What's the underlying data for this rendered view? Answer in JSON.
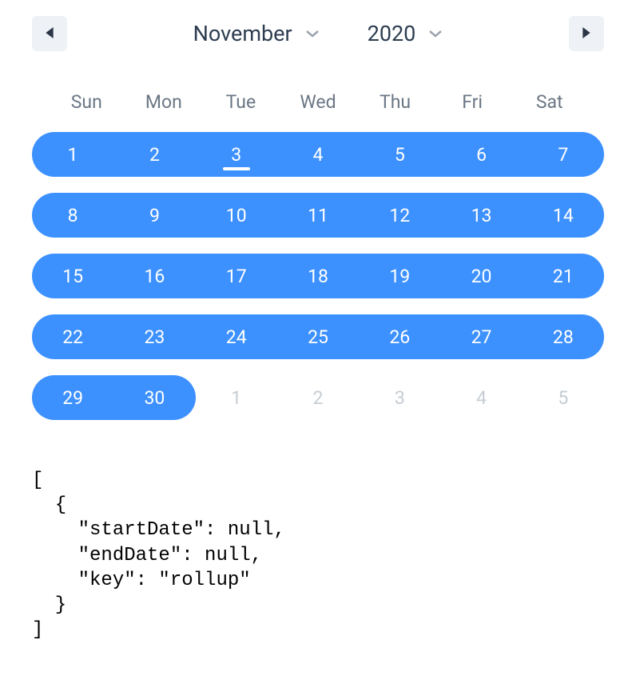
{
  "header": {
    "month": "November",
    "year": "2020"
  },
  "weekdays": [
    "Sun",
    "Mon",
    "Tue",
    "Wed",
    "Thu",
    "Fri",
    "Sat"
  ],
  "weeks": [
    [
      {
        "n": "1",
        "selected": true,
        "rowStart": true
      },
      {
        "n": "2",
        "selected": true
      },
      {
        "n": "3",
        "selected": true,
        "today": true
      },
      {
        "n": "4",
        "selected": true
      },
      {
        "n": "5",
        "selected": true
      },
      {
        "n": "6",
        "selected": true
      },
      {
        "n": "7",
        "selected": true,
        "rowEnd": true
      }
    ],
    [
      {
        "n": "8",
        "selected": true,
        "rowStart": true
      },
      {
        "n": "9",
        "selected": true
      },
      {
        "n": "10",
        "selected": true
      },
      {
        "n": "11",
        "selected": true
      },
      {
        "n": "12",
        "selected": true
      },
      {
        "n": "13",
        "selected": true
      },
      {
        "n": "14",
        "selected": true,
        "rowEnd": true
      }
    ],
    [
      {
        "n": "15",
        "selected": true,
        "rowStart": true
      },
      {
        "n": "16",
        "selected": true
      },
      {
        "n": "17",
        "selected": true
      },
      {
        "n": "18",
        "selected": true
      },
      {
        "n": "19",
        "selected": true
      },
      {
        "n": "20",
        "selected": true
      },
      {
        "n": "21",
        "selected": true,
        "rowEnd": true
      }
    ],
    [
      {
        "n": "22",
        "selected": true,
        "rowStart": true
      },
      {
        "n": "23",
        "selected": true
      },
      {
        "n": "24",
        "selected": true
      },
      {
        "n": "25",
        "selected": true
      },
      {
        "n": "26",
        "selected": true
      },
      {
        "n": "27",
        "selected": true
      },
      {
        "n": "28",
        "selected": true,
        "rowEnd": true
      }
    ],
    [
      {
        "n": "29",
        "selected": true,
        "rowStart": true
      },
      {
        "n": "30",
        "selected": true,
        "rowEnd": true
      },
      {
        "n": "1",
        "outside": true
      },
      {
        "n": "2",
        "outside": true
      },
      {
        "n": "3",
        "outside": true
      },
      {
        "n": "4",
        "outside": true
      },
      {
        "n": "5",
        "outside": true
      }
    ]
  ],
  "codeOutput": "[\n  {\n    \"startDate\": null,\n    \"endDate\": null,\n    \"key\": \"rollup\"\n  }\n]"
}
